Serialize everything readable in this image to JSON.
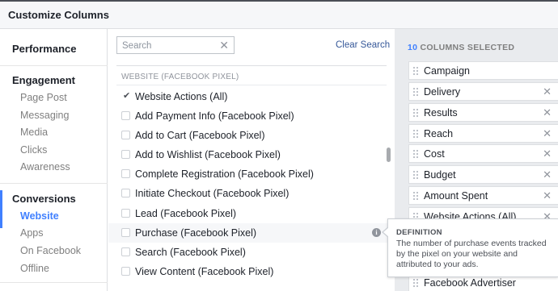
{
  "dialog": {
    "title": "Customize Columns"
  },
  "sidebar": {
    "groups": [
      {
        "label": "Performance",
        "items": []
      },
      {
        "label": "Engagement",
        "items": [
          "Page Post",
          "Messaging",
          "Media",
          "Clicks",
          "Awareness"
        ]
      },
      {
        "label": "Conversions",
        "items": [
          "Website",
          "Apps",
          "On Facebook",
          "Offline"
        ]
      }
    ],
    "active_item": "Website",
    "accent_color": "#4080ff"
  },
  "search": {
    "placeholder": "Search",
    "value": "",
    "clear_label": "Clear Search"
  },
  "section": {
    "heading": "WEBSITE (FACEBOOK PIXEL)"
  },
  "options": [
    {
      "label": "Website Actions (All)",
      "checked": true
    },
    {
      "label": "Add Payment Info (Facebook Pixel)",
      "checked": false
    },
    {
      "label": "Add to Cart (Facebook Pixel)",
      "checked": false
    },
    {
      "label": "Add to Wishlist (Facebook Pixel)",
      "checked": false
    },
    {
      "label": "Complete Registration (Facebook Pixel)",
      "checked": false
    },
    {
      "label": "Initiate Checkout (Facebook Pixel)",
      "checked": false
    },
    {
      "label": "Lead (Facebook Pixel)",
      "checked": false
    },
    {
      "label": "Purchase (Facebook Pixel)",
      "checked": false
    },
    {
      "label": "Search (Facebook Pixel)",
      "checked": false
    },
    {
      "label": "View Content (Facebook Pixel)",
      "checked": false
    }
  ],
  "selected": {
    "count": "10",
    "heading_suffix": "COLUMNS SELECTED",
    "columns": [
      "Campaign",
      "Delivery",
      "Results",
      "Reach",
      "Cost",
      "Budget",
      "Amount Spent",
      "Website Actions (All)",
      "",
      "Facebook Advertiser"
    ]
  },
  "tooltip": {
    "title": "DEFINITION",
    "text": "The number of purchase events tracked by the pixel on your website and attributed to your ads."
  }
}
